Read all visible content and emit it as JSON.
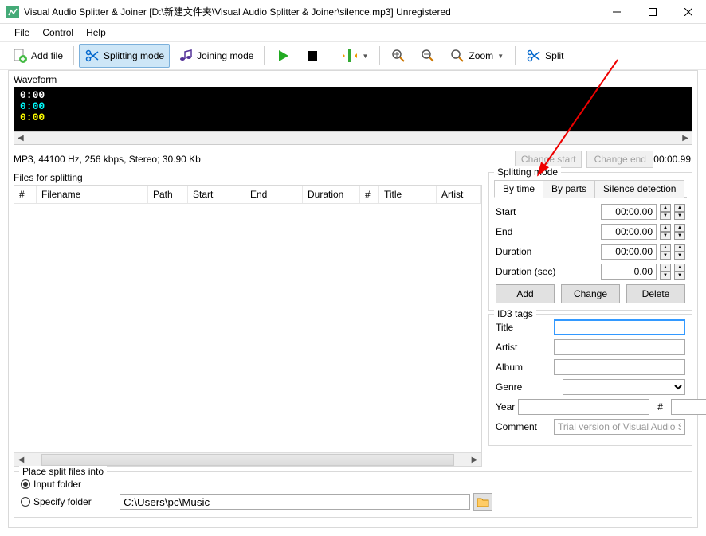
{
  "window": {
    "title": "Visual Audio Splitter & Joiner [D:\\新建文件夹\\Visual Audio Splitter & Joiner\\silence.mp3] Unregistered"
  },
  "menu": {
    "file": "File",
    "control": "Control",
    "help": "Help"
  },
  "toolbar": {
    "add_file": "Add file",
    "splitting_mode": "Splitting mode",
    "joining_mode": "Joining mode",
    "zoom": "Zoom",
    "split": "Split"
  },
  "waveform": {
    "label": "Waveform",
    "t1": "0:00",
    "t2": "0:00",
    "t3": "0:00"
  },
  "info": {
    "text": "MP3, 44100 Hz, 256 kbps, Stereo; 30.90 Kb",
    "change_start": "Change start",
    "change_end": "Change end",
    "time": "00:00.99"
  },
  "files": {
    "label": "Files for splitting",
    "cols": [
      "#",
      "Filename",
      "Path",
      "Start",
      "End",
      "Duration",
      "#",
      "Title",
      "Artist"
    ]
  },
  "splitting": {
    "label": "Splitting mode",
    "tabs": [
      "By time",
      "By parts",
      "Silence detection"
    ],
    "start": "Start",
    "start_val": "00:00.00",
    "end": "End",
    "end_val": "00:00.00",
    "duration": "Duration",
    "duration_val": "00:00.00",
    "duration_sec": "Duration (sec)",
    "duration_sec_val": "0.00",
    "add": "Add",
    "change": "Change",
    "delete": "Delete"
  },
  "id3": {
    "label": "ID3 tags",
    "title": "Title",
    "title_val": "",
    "artist": "Artist",
    "artist_val": "",
    "album": "Album",
    "album_val": "",
    "genre": "Genre",
    "genre_val": "",
    "year": "Year",
    "year_val": "",
    "hash": "#",
    "hash_val": "",
    "comment": "Comment",
    "comment_val": "Trial version of Visual Audio Splitter &"
  },
  "output": {
    "label": "Place split files into",
    "input_folder": "Input folder",
    "specify_folder": "Specify folder",
    "path": "C:\\Users\\pc\\Music"
  }
}
